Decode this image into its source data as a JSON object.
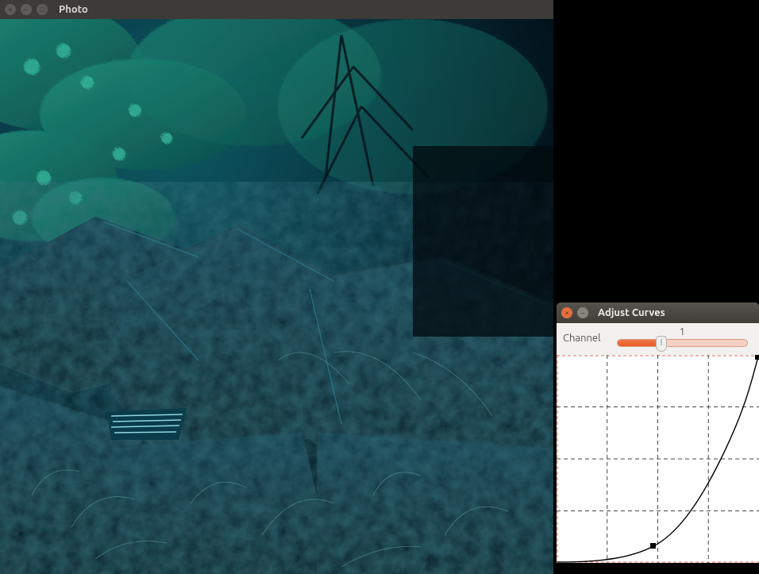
{
  "photo_window": {
    "title": "Photo",
    "buttons": {
      "close": "×",
      "minimize": "–",
      "maximize": "□"
    }
  },
  "curves_window": {
    "title": "Adjust Curves",
    "buttons": {
      "close": "×",
      "minimize": "–"
    },
    "channel": {
      "label": "Channel",
      "value": "1",
      "slider_min": 0,
      "slider_max": 2,
      "slider_position_fraction": 0.33
    },
    "curve": {
      "grid_divisions": 4,
      "control_points": [
        {
          "x": 0.0,
          "y": 0.0
        },
        {
          "x": 0.48,
          "y": 0.08
        },
        {
          "x": 1.0,
          "y": 1.0
        }
      ]
    }
  }
}
